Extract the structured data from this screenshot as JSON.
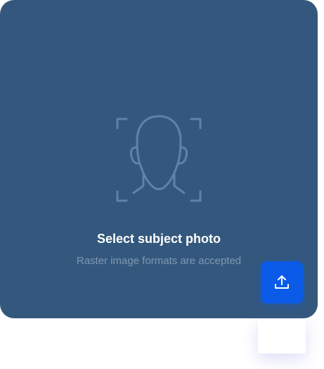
{
  "dropzone": {
    "title": "Select subject photo",
    "subtitle": "Raster image formats are accepted",
    "illustration_icon": "face-scan-icon",
    "upload_icon": "upload-icon"
  },
  "colors": {
    "card_background": "#34587d",
    "title_text": "#ffffff",
    "subtitle_text": "#7f97b3",
    "icon_stroke": "#5f82ab",
    "upload_button": "#0b5be8"
  }
}
